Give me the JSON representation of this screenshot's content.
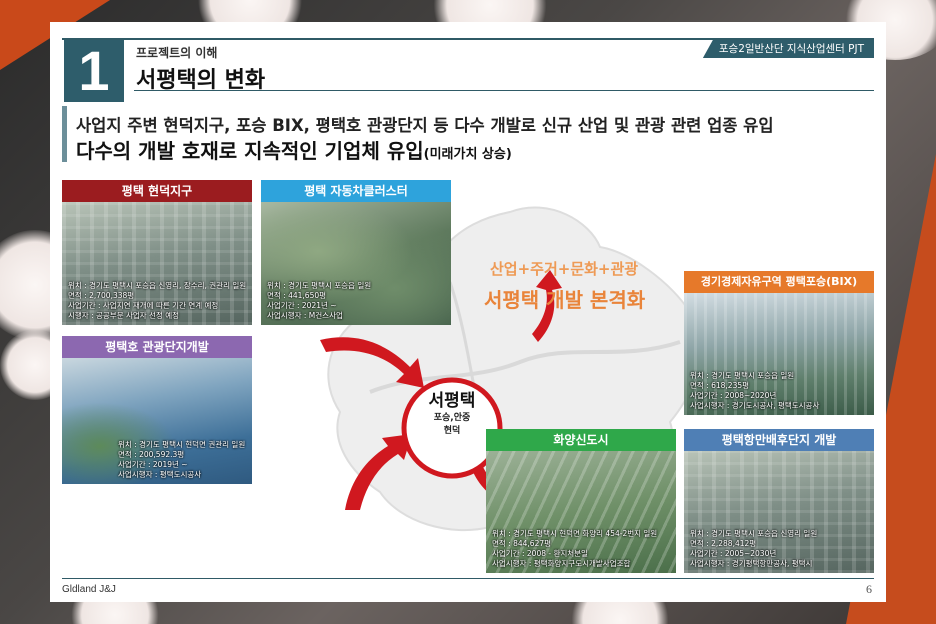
{
  "header": {
    "number": "1",
    "subtitle": "프로젝트의 이해",
    "title": "서평택의 변화",
    "project_tag": "포승2일반산단 지식산업센터 PJT"
  },
  "lead": {
    "line1": "사업지 주변 현덕지구, 포승 BIX, 평택호 관광단지 등 다수 개발로 신규 산업 및 관광 관련 업종 유입",
    "line2": "다수의 개발 호재로 지속적인 기업체 유입",
    "line2_suffix": "(미래가치 상승)"
  },
  "center": {
    "slogan": "산업+주거+문화+관광",
    "headline": "서평택 개발 본격화",
    "circle_title": "서평택",
    "circle_line1": "포승,안중",
    "circle_line2": "현덕"
  },
  "cards": {
    "hyeondeok": {
      "title": "평택 현덕지구",
      "lines": [
        "위치 : 경기도 평택시 포승읍 신영리, 장수리, 권관리 일원",
        "면적 : 2,700,338평",
        "사업기간 : 사업지연 재개에 따른 기간 연계 예정",
        "시행자 : 공공부문 사업자 선정 예정"
      ]
    },
    "auto": {
      "title": "평택 자동차클러스터",
      "lines": [
        "위치 : 경기도 평택시 포승읍 일원",
        "면적 : 441,650평",
        "사업기간 : 2021년 ~",
        "사업시행자 : M건스사업"
      ]
    },
    "lake": {
      "title": "평택호 관광단지개발",
      "lines": [
        "위치 : 경기도 평택시 현덕면 권관리 일원",
        "면적 : 200,592.3평",
        "사업기간 : 2019년 ~",
        "사업시행자 : 평택도시공사"
      ]
    },
    "bix": {
      "title": "경기경제자유구역 평택포승(BIX)",
      "lines": [
        "위치 : 경기도 평택시 포승읍 일원",
        "면적 : 618,235평",
        "사업기간 : 2008~2020년",
        "사업시행자 : 경기도시공사, 평택도시공사"
      ]
    },
    "hwayang": {
      "title": "화양신도시",
      "lines": [
        "위치 : 경기도 평택시 현덕면 화양리 454-2번지 일원",
        "면적 : 844,627평",
        "사업기간 : 2008 - 환지처분일",
        "사업시행자 : 평택화양지구도시개발사업조합"
      ]
    },
    "port": {
      "title": "평택항만배후단지 개발",
      "lines": [
        "위치 : 경기도 평택시 포승읍 신영리 일원",
        "면적 : 2,288,412평",
        "사업기간 : 2005~2030년",
        "사업시행자 : 경기평택항만공사, 평택시"
      ]
    }
  },
  "colors": {
    "teal": "#2e5d6b",
    "dark_red": "#9b1c1f",
    "sky_blue": "#2ea3dc",
    "purple": "#8c68b0",
    "orange": "#e6792a",
    "green": "#2fa84a",
    "steel_blue": "#4f7fb5",
    "arrow_red": "#d0181f"
  },
  "footer": {
    "company": "Gldland J&J",
    "page": "6"
  }
}
